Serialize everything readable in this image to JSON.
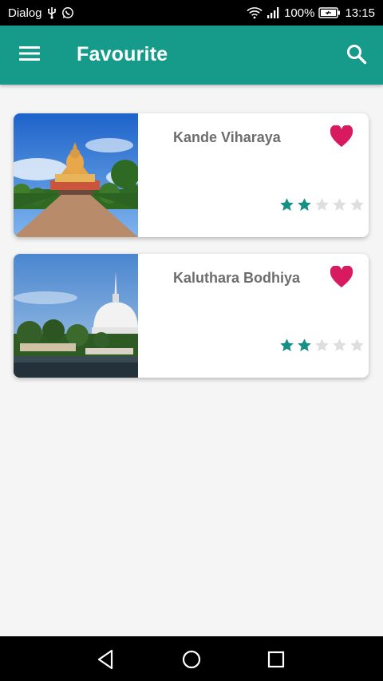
{
  "status_bar": {
    "carrier": "Dialog",
    "battery": "100%",
    "time": "13:15",
    "icons": [
      "usb-icon",
      "whatsapp-icon",
      "wifi-icon",
      "signal-icon",
      "battery-icon"
    ]
  },
  "app_bar": {
    "title": "Favourite",
    "background": "#169b8b",
    "icons": [
      "menu-icon",
      "search-icon"
    ]
  },
  "favourites": [
    {
      "name": "Kande Viharaya",
      "rating": 2,
      "max_rating": 5,
      "favorited": true
    },
    {
      "name": "Kaluthara Bodhiya",
      "rating": 2,
      "max_rating": 5,
      "favorited": true
    }
  ],
  "colors": {
    "accent": "#169b8b",
    "heart": "#d81b60",
    "star_filled": "#168f84",
    "star_empty": "#dedede",
    "title_text": "#6d6d6d"
  },
  "nav_bar": {
    "icons": [
      "back-triangle-icon",
      "home-circle-icon",
      "recents-square-icon"
    ]
  }
}
